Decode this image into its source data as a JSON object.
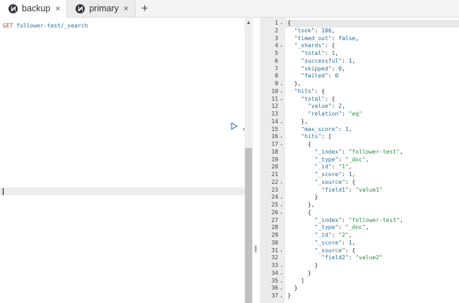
{
  "tabs": [
    {
      "label": "backup",
      "active": true,
      "icon": "kibana-logo-icon",
      "close": "×"
    },
    {
      "label": "primary",
      "active": false,
      "icon": "kibana-logo-icon",
      "close": "×"
    }
  ],
  "add_tab": "+",
  "request": {
    "method": "GET",
    "path": "follower-test/_search",
    "run_icon": "play-icon",
    "settings_icon": "wrench-icon"
  },
  "scrollbar": {
    "up_arrow": "▲"
  },
  "splitter": {
    "grip": "||"
  },
  "response": {
    "lines": [
      {
        "n": "1",
        "fold": "▾",
        "t": "{"
      },
      {
        "n": "2",
        "fold": "",
        "t": "  \"took\": 106,"
      },
      {
        "n": "3",
        "fold": "",
        "t": "  \"timed_out\": false,"
      },
      {
        "n": "4",
        "fold": "▾",
        "t": "  \"_shards\": {"
      },
      {
        "n": "5",
        "fold": "",
        "t": "    \"total\": 1,"
      },
      {
        "n": "6",
        "fold": "",
        "t": "    \"successful\": 1,"
      },
      {
        "n": "7",
        "fold": "",
        "t": "    \"skipped\": 0,"
      },
      {
        "n": "8",
        "fold": "",
        "t": "    \"failed\": 0"
      },
      {
        "n": "9",
        "fold": "▴",
        "t": "  },"
      },
      {
        "n": "10",
        "fold": "▾",
        "t": "  \"hits\": {"
      },
      {
        "n": "11",
        "fold": "▾",
        "t": "    \"total\": {"
      },
      {
        "n": "12",
        "fold": "",
        "t": "      \"value\": 2,"
      },
      {
        "n": "13",
        "fold": "",
        "t": "      \"relation\": \"eq\""
      },
      {
        "n": "14",
        "fold": "▴",
        "t": "    },"
      },
      {
        "n": "15",
        "fold": "",
        "t": "    \"max_score\": 1,"
      },
      {
        "n": "16",
        "fold": "▾",
        "t": "    \"hits\": ["
      },
      {
        "n": "17",
        "fold": "▾",
        "t": "      {"
      },
      {
        "n": "18",
        "fold": "",
        "t": "        \"_index\": \"follower-test\","
      },
      {
        "n": "19",
        "fold": "",
        "t": "        \"_type\": \"_doc\","
      },
      {
        "n": "20",
        "fold": "",
        "t": "        \"_id\": \"1\","
      },
      {
        "n": "21",
        "fold": "",
        "t": "        \"_score\": 1,"
      },
      {
        "n": "22",
        "fold": "▾",
        "t": "        \"_source\": {"
      },
      {
        "n": "23",
        "fold": "",
        "t": "          \"field1\": \"value1\""
      },
      {
        "n": "24",
        "fold": "▴",
        "t": "        }"
      },
      {
        "n": "25",
        "fold": "▴",
        "t": "      },"
      },
      {
        "n": "26",
        "fold": "▾",
        "t": "      {"
      },
      {
        "n": "27",
        "fold": "",
        "t": "        \"_index\": \"follower-test\","
      },
      {
        "n": "28",
        "fold": "",
        "t": "        \"_type\": \"_doc\","
      },
      {
        "n": "29",
        "fold": "",
        "t": "        \"_id\": \"2\","
      },
      {
        "n": "30",
        "fold": "",
        "t": "        \"_score\": 1,"
      },
      {
        "n": "31",
        "fold": "▾",
        "t": "        \"_source\": {"
      },
      {
        "n": "32",
        "fold": "",
        "t": "          \"field2\": \"value2\""
      },
      {
        "n": "33",
        "fold": "▴",
        "t": "        }"
      },
      {
        "n": "34",
        "fold": "▴",
        "t": "      }"
      },
      {
        "n": "35",
        "fold": "▴",
        "t": "    ]"
      },
      {
        "n": "36",
        "fold": "▴",
        "t": "  }"
      },
      {
        "n": "37",
        "fold": "▴",
        "t": "}"
      }
    ]
  }
}
